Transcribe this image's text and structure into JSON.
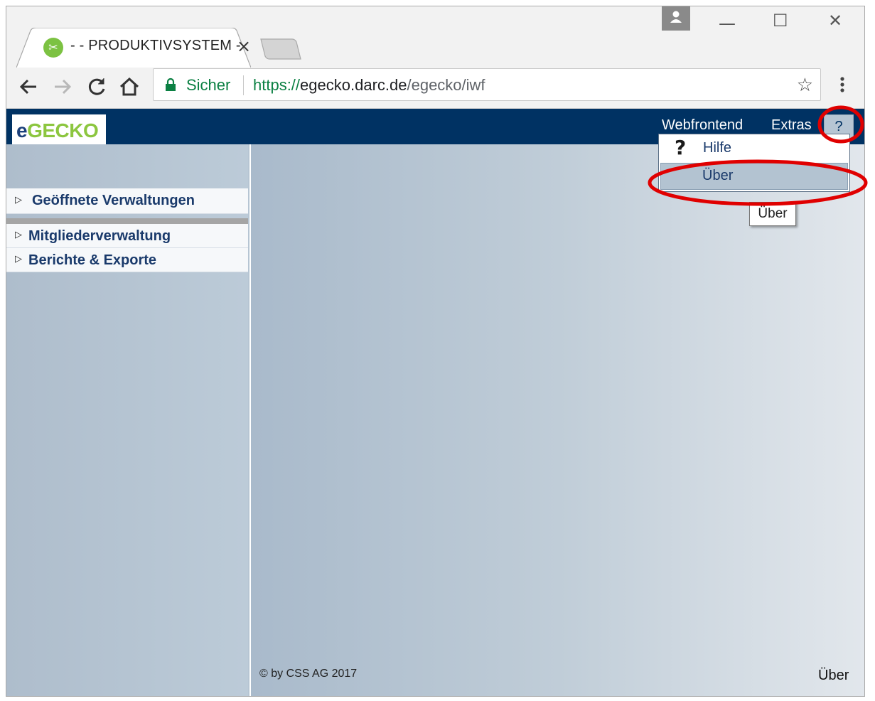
{
  "browser": {
    "tab_title": "- - PRODUKTIVSYSTEM -",
    "tab_close": "×",
    "secure_label": "Sicher",
    "url_scheme": "https://",
    "url_host": "egecko.darc.de",
    "url_path": "/egecko/iwf",
    "star": "☆",
    "win_minimize": "—",
    "win_maximize": "☐",
    "win_close": "✕"
  },
  "app": {
    "logo_e": "e",
    "logo_gecko": "GECKO",
    "menu": {
      "webfrontend": "Webfrontend",
      "extras": "Extras",
      "help": "?"
    },
    "dropdown": {
      "help_icon": "?",
      "help_label": "Hilfe",
      "ueber_label": "Über"
    },
    "tooltip": "Über",
    "sidebar": {
      "opened": "Geöffnete Verwaltungen",
      "items": [
        "Mitgliederverwaltung",
        "Berichte & Exporte"
      ]
    },
    "footer": {
      "copyright": "© by CSS AG 2017",
      "ueber_link": "Über"
    }
  },
  "colors": {
    "header": "#003263",
    "accent_green": "#8cc63f",
    "annotation_red": "#e00000"
  },
  "icons": [
    "back-arrow-icon",
    "forward-arrow-icon",
    "reload-icon",
    "home-icon",
    "lock-icon",
    "star-icon",
    "kebab-menu-icon",
    "profile-icon",
    "favicon-icon",
    "question-icon",
    "triangle-right-icon"
  ]
}
